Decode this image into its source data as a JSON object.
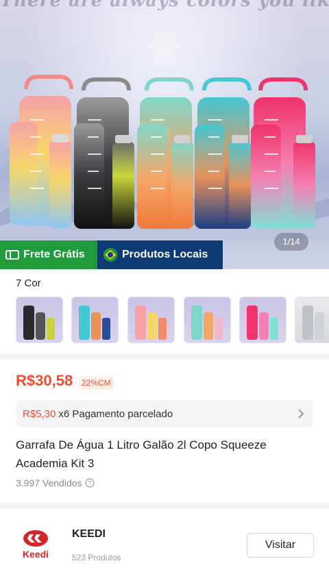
{
  "hero": {
    "tagline": "There are always colors you like!",
    "page_indicator": "1/14",
    "badges": {
      "free_shipping": "Frete Grátis",
      "local_products": "Produtos Locais"
    }
  },
  "colors": {
    "label": "7 Cor",
    "swatch_count": 6
  },
  "product": {
    "price": "R$30,58",
    "discount": "22%CM",
    "installment": {
      "amount": "R$5,30",
      "text": "x6 Pagamento parcelado"
    },
    "title": "Garrafa De Água 1 Litro Galão 2l Copo Squeeze Academia Kit 3",
    "sold": "3.997 Vendidos"
  },
  "shop": {
    "logo_text": "Keedi",
    "name": "KEEDI",
    "products": "523 Produtos",
    "visit_label": "Visitar"
  },
  "colors_palette": {
    "accent": "#ee4d2d",
    "free_shipping_bg": "#1f9b3c",
    "local_bg": "#0e3a73"
  }
}
